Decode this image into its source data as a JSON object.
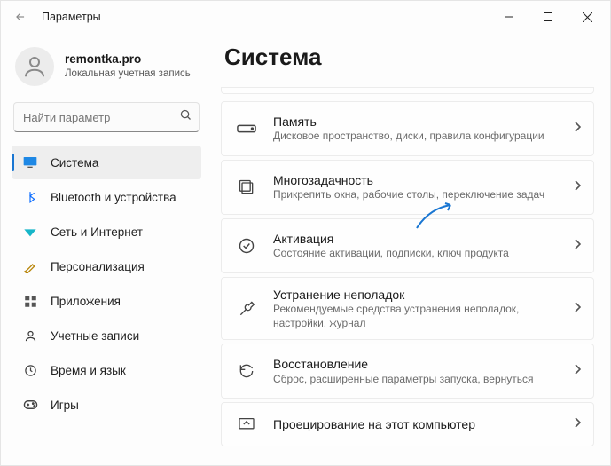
{
  "titlebar": {
    "title": "Параметры"
  },
  "user": {
    "name": "remontka.pro",
    "sub": "Локальная учетная запись"
  },
  "search": {
    "placeholder": "Найти параметр"
  },
  "sidebar": {
    "items": [
      {
        "label": "Система",
        "icon": "system",
        "selected": true
      },
      {
        "label": "Bluetooth и устройства",
        "icon": "bluetooth"
      },
      {
        "label": "Сеть и Интернет",
        "icon": "network"
      },
      {
        "label": "Персонализация",
        "icon": "personalize"
      },
      {
        "label": "Приложения",
        "icon": "apps"
      },
      {
        "label": "Учетные записи",
        "icon": "accounts"
      },
      {
        "label": "Время и язык",
        "icon": "timelang"
      },
      {
        "label": "Игры",
        "icon": "gaming"
      }
    ]
  },
  "main": {
    "heading": "Система",
    "cards": [
      {
        "title": "Память",
        "sub": "Дисковое пространство, диски, правила конфигурации",
        "icon": "storage"
      },
      {
        "title": "Многозадачность",
        "sub": "Прикрепить окна, рабочие столы, переключение задач",
        "icon": "multitask"
      },
      {
        "title": "Активация",
        "sub": "Состояние активации, подписки, ключ продукта",
        "icon": "activation"
      },
      {
        "title": "Устранение неполадок",
        "sub": "Рекомендуемые средства устранения неполадок, настройки, журнал",
        "icon": "troubleshoot"
      },
      {
        "title": "Восстановление",
        "sub": "Сброс, расширенные параметры запуска, вернуться",
        "icon": "recovery"
      },
      {
        "title": "Проецирование на этот компьютер",
        "sub": "",
        "icon": "project"
      }
    ]
  }
}
